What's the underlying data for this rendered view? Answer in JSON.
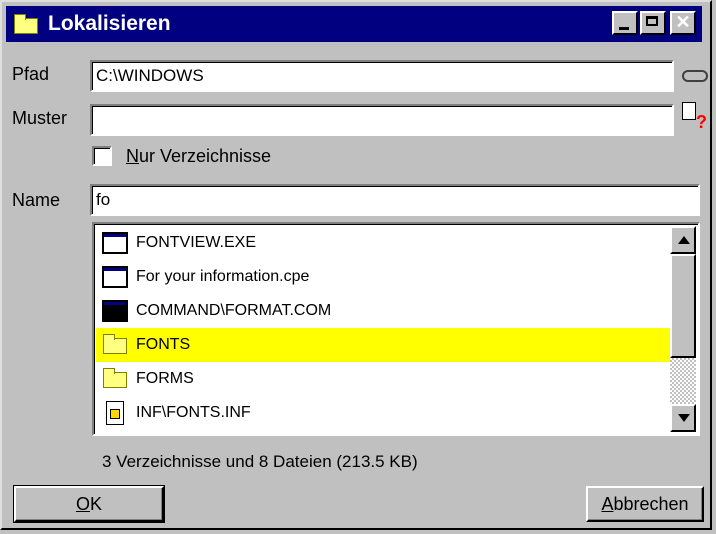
{
  "window": {
    "title": "Lokalisieren",
    "controls": {
      "close_glyph": "✕"
    }
  },
  "path": {
    "label": "Pfad",
    "value": "C:\\WINDOWS"
  },
  "pattern": {
    "label": "Muster",
    "value": ""
  },
  "dirs_only": {
    "label": "Nur Verzeichnisse",
    "checked": false
  },
  "name": {
    "label": "Name",
    "value": "fo"
  },
  "files": [
    {
      "name": "FONTVIEW.EXE",
      "icon": "app-window-icon",
      "selected": false
    },
    {
      "name": "For your information.cpe",
      "icon": "app-window-icon",
      "selected": false
    },
    {
      "name": "COMMAND\\FORMAT.COM",
      "icon": "dos-window-icon",
      "selected": false
    },
    {
      "name": "FONTS",
      "icon": "folder-icon",
      "selected": true
    },
    {
      "name": "FORMS",
      "icon": "folder-icon",
      "selected": false
    },
    {
      "name": "INF\\FONTS.INF",
      "icon": "inf-document-icon",
      "selected": false
    }
  ],
  "status": "3 Verzeichnisse und 8 Dateien (213.5 KB)",
  "buttons": {
    "ok": "OK",
    "cancel": "Abbrechen"
  },
  "colors": {
    "titlebar": "#000080",
    "selection": "#ffff00",
    "face": "#c0c0c0"
  }
}
